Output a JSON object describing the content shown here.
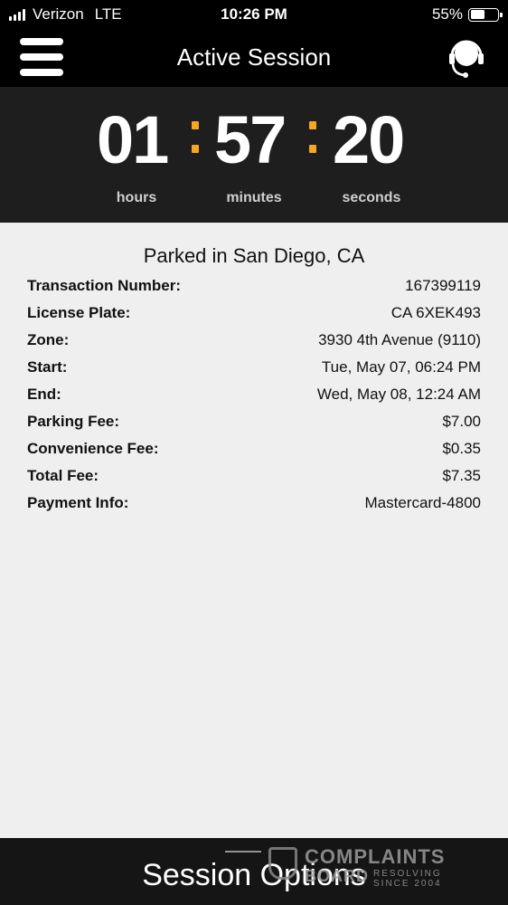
{
  "status_bar": {
    "carrier": "Verizon",
    "network": "LTE",
    "time": "10:26 PM",
    "battery_percent": "55%",
    "battery_level": 0.55
  },
  "nav": {
    "title": "Active Session",
    "menu_icon": "hamburger-menu-icon",
    "support_icon": "headset-icon"
  },
  "timer": {
    "hours": "01",
    "minutes": "57",
    "seconds": "20",
    "hours_label": "hours",
    "minutes_label": "minutes",
    "seconds_label": "seconds",
    "separator_color": "#f5a623"
  },
  "details": {
    "location": "Parked in San Diego, CA",
    "rows": [
      {
        "label": "Transaction Number:",
        "value": "167399119"
      },
      {
        "label": "License Plate:",
        "value": "CA 6XEK493"
      },
      {
        "label": "Zone:",
        "value": "3930 4th Avenue (9110)"
      },
      {
        "label": "Start:",
        "value": "Tue, May 07, 06:24 PM"
      },
      {
        "label": "End:",
        "value": "Wed, May 08, 12:24 AM"
      },
      {
        "label": "Parking Fee:",
        "value": "$7.00"
      },
      {
        "label": "Convenience Fee:",
        "value": "$0.35"
      },
      {
        "label": "Total Fee:",
        "value": "$7.35"
      },
      {
        "label": "Payment Info:",
        "value": "Mastercard-4800"
      }
    ]
  },
  "footer": {
    "session_options_label": "Session Options",
    "watermark": {
      "brand": "COMPLAINTS",
      "sub": "BOARD",
      "tagline_1": "RESOLVING",
      "tagline_2": "SINCE 2004"
    }
  }
}
